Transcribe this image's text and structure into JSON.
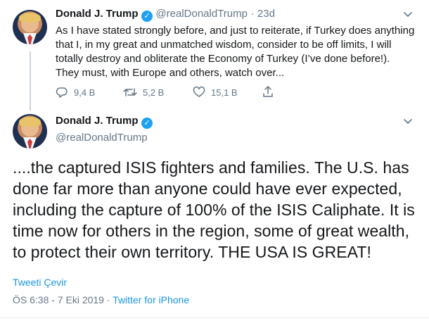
{
  "first_tweet": {
    "display_name": "Donald J. Trump",
    "handle": "@realDonaldTrump",
    "separator": "·",
    "time_ago": "23d",
    "text": "As I have stated strongly before, and just to reiterate, if Turkey does anything that I, in my great and unmatched wisdom, consider to be off limits, I will totally destroy and obliterate the Economy of Turkey (I’ve done before!). They must, with Europe and others, watch over...",
    "replies": "9,4 B",
    "retweets": "5,2 B",
    "likes": "15,1 B"
  },
  "main_tweet": {
    "display_name": "Donald J. Trump",
    "handle": "@realDonaldTrump",
    "text": "....the captured ISIS fighters and families. The U.S. has done far more than anyone could have ever expected, including the capture of 100% of the ISIS Caliphate. It is time now for others in the region, some of great wealth, to protect their own territory. THE USA IS GREAT!",
    "translate_label": "Tweeti Çevir",
    "timestamp": "ÖS 6:38 - 7 Eki 2019",
    "meta_separator": "·",
    "source": "Twitter for iPhone"
  },
  "colors": {
    "accent": "#1b95e0",
    "verified": "#1da1f2",
    "muted": "#657786"
  }
}
